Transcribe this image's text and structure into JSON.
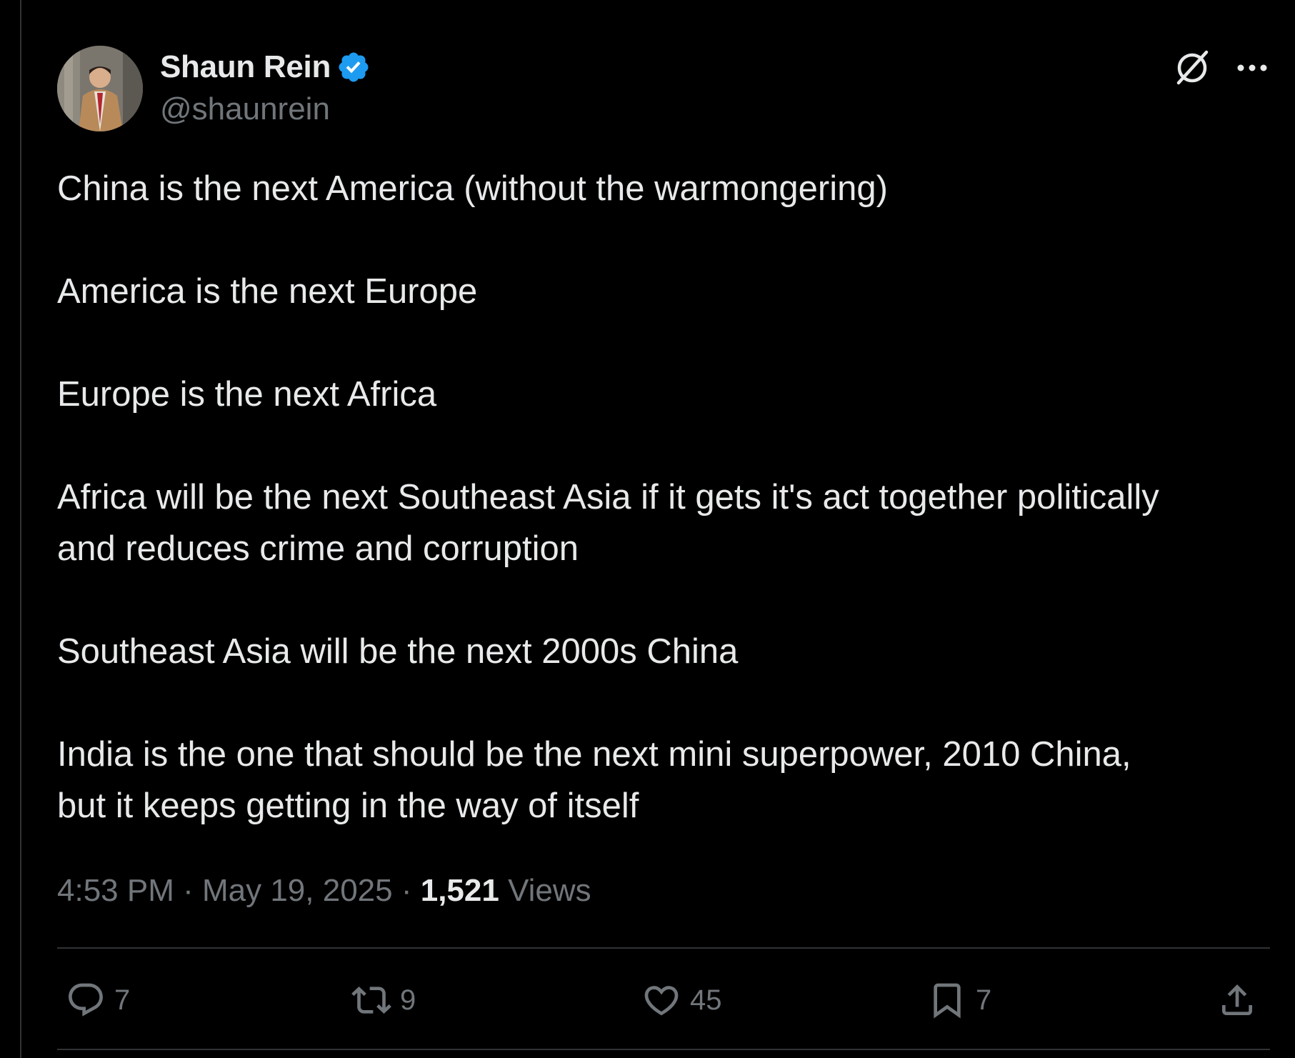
{
  "author": {
    "display_name": "Shaun Rein",
    "handle": "@shaunrein",
    "verified": true,
    "avatar": "profile-photo"
  },
  "header_icons": {
    "grok": "grok-icon",
    "more": "more-icon"
  },
  "post": {
    "paragraphs": [
      [
        "China is the next America (without the warmongering)"
      ],
      [
        "America is the next Europe"
      ],
      [
        "Europe is the next Africa"
      ],
      [
        "Africa will be the next Southeast Asia if it gets it's act together politically",
        "and reduces crime and corruption"
      ],
      [
        "Southeast Asia will be the next 2000s China"
      ],
      [
        "India is the one that should be the next mini superpower, 2010 China,",
        "but it keeps getting in the way of itself"
      ]
    ]
  },
  "meta": {
    "time": "4:53 PM",
    "separator": " · ",
    "date": "May 19, 2025",
    "views_count": "1,521",
    "views_label": "Views"
  },
  "actions": {
    "replies": "7",
    "reposts": "9",
    "likes": "45",
    "bookmarks": "7"
  },
  "colors": {
    "background": "#000000",
    "text": "#e7e9ea",
    "muted": "#71767b",
    "divider": "#2f3336",
    "verified": "#1d9bf0"
  }
}
